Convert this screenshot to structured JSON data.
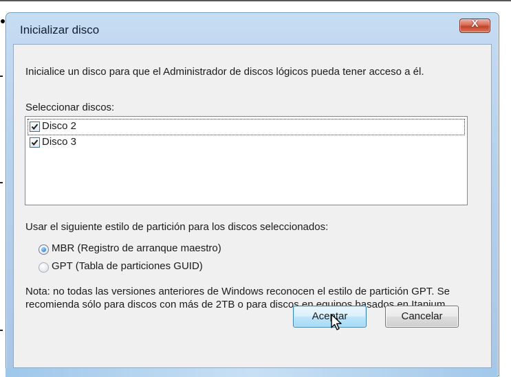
{
  "dialog": {
    "title": "Inicializar disco",
    "description": "Inicialice un disco para que el Administrador de discos lógicos pueda tener acceso a él.",
    "select_label": "Seleccionar discos:",
    "disks": [
      {
        "label": "Disco 2",
        "checked": true
      },
      {
        "label": "Disco 3",
        "checked": true
      }
    ],
    "partition_label": "Usar el siguiente estilo de partición para los discos seleccionados:",
    "options": [
      {
        "label": "MBR (Registro de arranque maestro)",
        "selected": true
      },
      {
        "label": "GPT (Tabla de particiones GUID)",
        "selected": false
      }
    ],
    "note": "Nota: no todas las versiones anteriores de Windows reconocen el estilo de partición GPT. Se recomienda sólo para discos con más de 2TB o para discos en equipos basados en Itanium.",
    "accept_label": "Aceptar",
    "cancel_label": "Cancelar",
    "close_glyph": "X"
  },
  "icons": {
    "close": "close-icon",
    "checkbox": "checkmark-icon",
    "radio": "radio-icon",
    "cursor": "pointer-cursor-icon"
  },
  "colors": {
    "titlebar": "#b6d0ea",
    "client": "#f0f0f0",
    "close_button": "#c0432a",
    "default_button_border": "#3c7fb1"
  }
}
